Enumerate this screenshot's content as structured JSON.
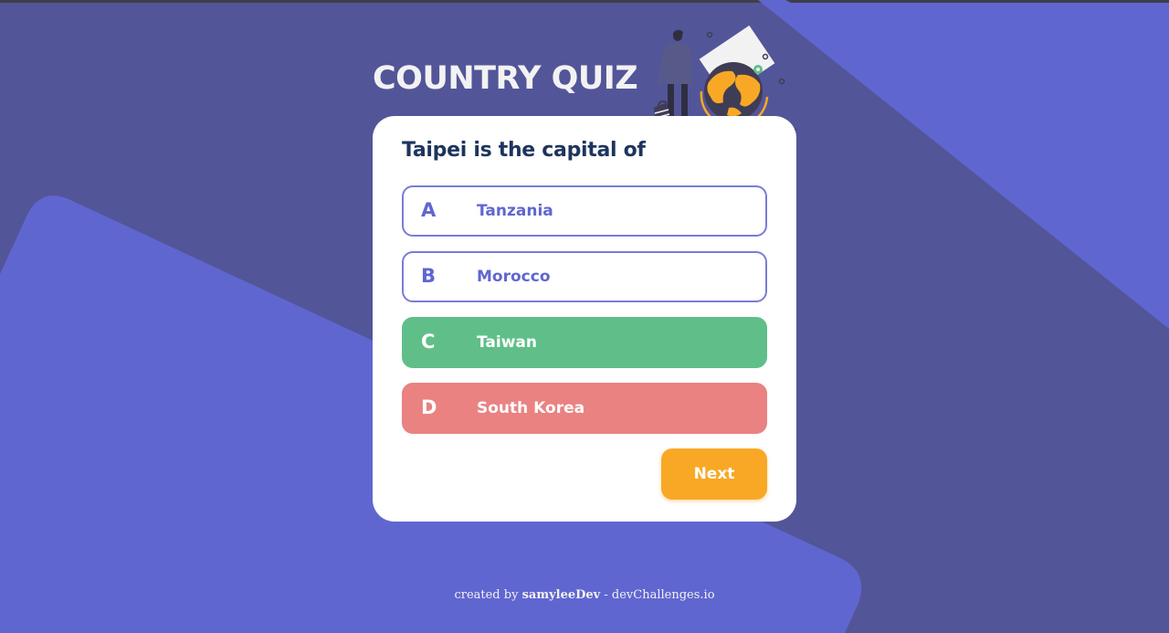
{
  "app": {
    "title": "COUNTRY QUIZ"
  },
  "quiz": {
    "question": "Taipei is the capital of",
    "options": [
      {
        "letter": "A",
        "label": "Tanzania",
        "state": "default"
      },
      {
        "letter": "B",
        "label": "Morocco",
        "state": "default"
      },
      {
        "letter": "C",
        "label": "Taiwan",
        "state": "correct"
      },
      {
        "letter": "D",
        "label": "South Korea",
        "state": "wrong"
      }
    ],
    "next_label": "Next"
  },
  "footer": {
    "prefix": "created by",
    "author": "samyleeDev",
    "separator": "-",
    "site": "devChallenges.io"
  },
  "colors": {
    "background": "#535599",
    "accent_shape": "#6066d0",
    "option_default": "#6066d0",
    "correct": "#60bf88",
    "wrong": "#ea8282",
    "next_button": "#f9a826",
    "question_text": "#1d355d"
  },
  "icons": {
    "header_illustration": "traveler-with-globe-icon"
  }
}
